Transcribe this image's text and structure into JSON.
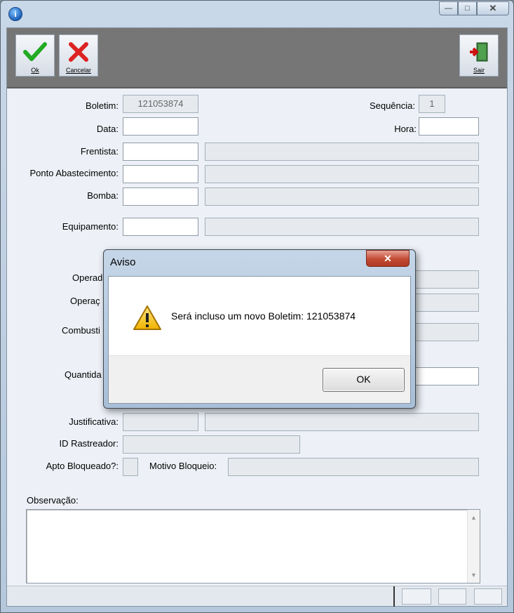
{
  "window": {
    "title": "",
    "app_icon": "i-info-icon",
    "controls": {
      "minimize": "—",
      "maximize": "□",
      "close": "✕"
    }
  },
  "toolbar": {
    "ok": {
      "label": "Ok",
      "icon": "check-icon",
      "color": "#22aa22"
    },
    "cancel": {
      "label": "Cancelar",
      "icon": "x-icon",
      "color": "#dd2222"
    },
    "exit": {
      "label": "Sair",
      "icon": "exit-door-icon",
      "color": "#cc1111"
    }
  },
  "form": {
    "boletim": {
      "label": "Boletim:",
      "value": "121053874"
    },
    "sequencia": {
      "label": "Sequência:",
      "value": "1"
    },
    "data": {
      "label": "Data:",
      "value": ""
    },
    "hora": {
      "label": "Hora:",
      "value": ""
    },
    "frentista": {
      "label": "Frentista:",
      "value": ""
    },
    "ponto": {
      "label": "Ponto Abastecimento:",
      "value": ""
    },
    "bomba": {
      "label": "Bomba:",
      "value": ""
    },
    "equipamento": {
      "label": "Equipamento:",
      "value": ""
    },
    "operador": {
      "label": "Operad",
      "value": ""
    },
    "operacao": {
      "label": "Operaç",
      "value": ""
    },
    "combustivel": {
      "label": "Combusti",
      "value": ""
    },
    "quantidade": {
      "label": "Quantida",
      "value": ""
    },
    "justificativa": {
      "label": "Justificativa:",
      "value": ""
    },
    "id_rastreador": {
      "label": "ID Rastreador:",
      "value": ""
    },
    "apto_bloqueado": {
      "label": "Apto Bloqueado?:",
      "value": ""
    },
    "motivo_bloqueio": {
      "label": "Motivo Bloqueio:",
      "value": ""
    },
    "observacao": {
      "label": "Observação:",
      "value": ""
    }
  },
  "dialog": {
    "title": "Aviso",
    "close_glyph": "✕",
    "icon": "warning-icon",
    "message": "Será incluso um novo Boletim: 121053874",
    "ok_label": "OK"
  }
}
